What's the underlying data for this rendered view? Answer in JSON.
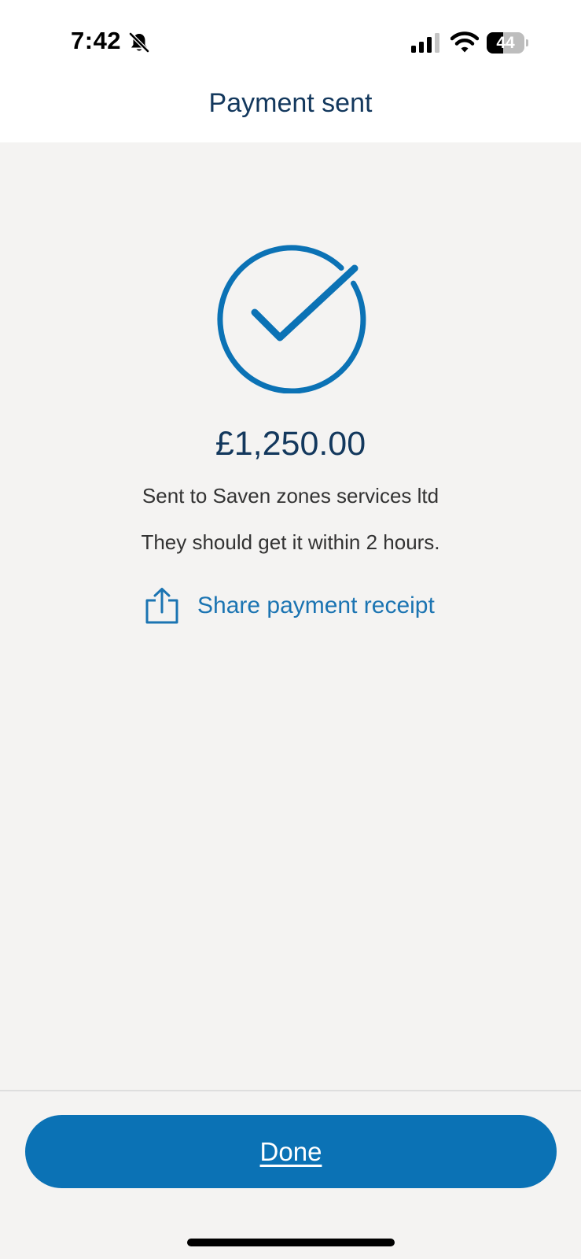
{
  "status_bar": {
    "time": "7:42",
    "battery_level": "44",
    "battery_percent": 44,
    "icons": [
      "bell-slash-icon",
      "cellular-signal-icon",
      "wifi-icon",
      "battery-icon"
    ]
  },
  "header": {
    "title": "Payment sent"
  },
  "confirmation": {
    "icon": "checkmark-circle-icon",
    "amount": "£1,250.00",
    "recipient_text": "Sent to Saven zones services ltd",
    "eta_text": "They should get it within 2 hours.",
    "share_label": "Share payment receipt",
    "share_icon": "share-icon"
  },
  "footer": {
    "done_label": "Done"
  },
  "colors": {
    "accent": "#0b72b5",
    "heading": "#13385d",
    "link": "#1b74b2",
    "background": "#f4f3f2"
  }
}
